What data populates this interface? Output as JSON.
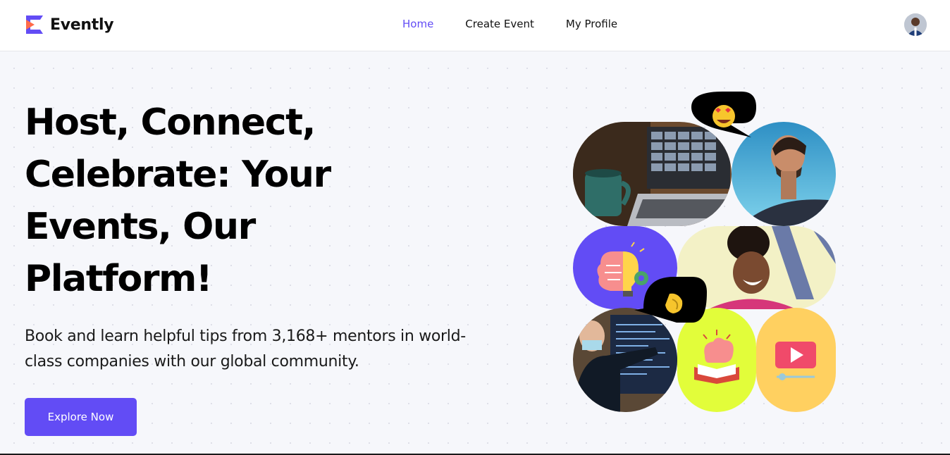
{
  "brand": {
    "name": "Evently",
    "logo_icon": "evently-logo-icon",
    "accent_color": "#624cf5",
    "logo_colors": [
      "#ff6b4a",
      "#624cf5"
    ]
  },
  "nav": {
    "items": [
      {
        "label": "Home",
        "active": true
      },
      {
        "label": "Create Event",
        "active": false
      },
      {
        "label": "My Profile",
        "active": false
      }
    ],
    "avatar_icon": "user-avatar"
  },
  "hero": {
    "title": "Host, Connect, Celebrate: Your Events, Our Platform!",
    "subtitle": "Book and learn helpful tips from 3,168+ mentors in world-class companies with our global community.",
    "cta_label": "Explore Now",
    "cta_color": "#624cf5"
  },
  "collage": {
    "tiles": [
      {
        "name": "laptop-video-call-photo",
        "icon": "photo"
      },
      {
        "name": "smiling-man-photo",
        "icon": "photo"
      },
      {
        "name": "brain-lightbulb-icon",
        "color": "#624cf5"
      },
      {
        "name": "laughing-woman-photo",
        "icon": "photo"
      },
      {
        "name": "presenter-photo",
        "icon": "photo"
      },
      {
        "name": "brain-book-icon",
        "color": "#e0ff3a"
      },
      {
        "name": "video-player-icon",
        "color": "#ffd060"
      }
    ],
    "bubbles": [
      {
        "name": "heart-eyes-emoji-bubble",
        "emoji": "😍"
      },
      {
        "name": "pinching-hand-emoji-bubble",
        "emoji": "🤌"
      }
    ]
  }
}
